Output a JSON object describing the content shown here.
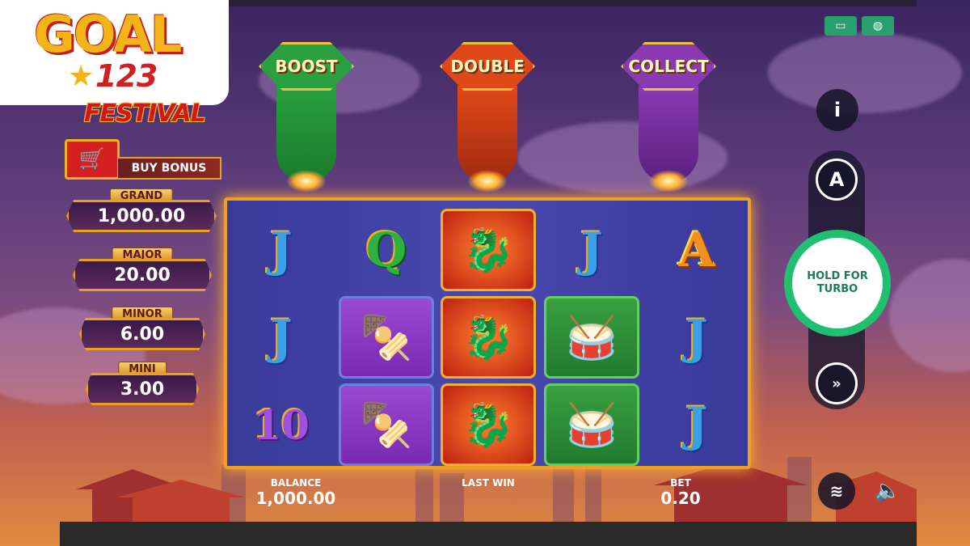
{
  "brand": {
    "goal": "GOAL",
    "number": "123"
  },
  "game_title": "FESTIVAL",
  "buy_bonus": {
    "label": "BUY BONUS"
  },
  "jackpots": [
    {
      "name": "GRAND",
      "value": "1,000.00"
    },
    {
      "name": "MAJOR",
      "value": "20.00"
    },
    {
      "name": "MINOR",
      "value": "6.00"
    },
    {
      "name": "MINI",
      "value": "3.00"
    }
  ],
  "features": [
    {
      "label": "BOOST",
      "color": "#2aa040"
    },
    {
      "label": "DOUBLE",
      "color": "#e04818"
    },
    {
      "label": "COLLECT",
      "color": "#8a3ab0"
    }
  ],
  "reels": {
    "rows": [
      [
        "J",
        "Q",
        "dragon",
        "J",
        "A"
      ],
      [
        "J",
        "shrimp",
        "dragon",
        "drum",
        "J"
      ],
      [
        "10",
        "shrimp",
        "dragon",
        "drum",
        "J"
      ]
    ]
  },
  "footer": {
    "balance_label": "BALANCE",
    "balance_value": "1,000.00",
    "last_win_label": "LAST WIN",
    "bet_label": "BET",
    "bet_value": "0.20"
  },
  "controls": {
    "info": "i",
    "auto": "A",
    "turbo_label": "HOLD FOR TURBO",
    "fast_icon": "fast-forward-icon",
    "stack_icon": "coins-icon",
    "sound_icon": "speaker-icon"
  },
  "colors": {
    "accent": "#f0a020",
    "turbo": "#20c070"
  }
}
